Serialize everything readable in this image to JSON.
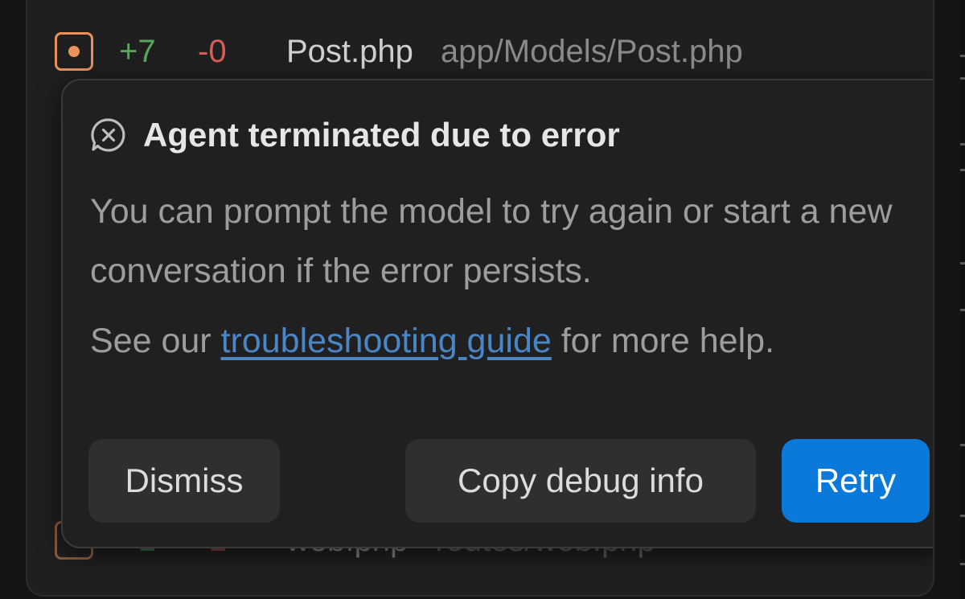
{
  "changed_files": [
    {
      "status_icon": "modified-file-icon",
      "additions": "+7",
      "deletions": "-0",
      "name": "Post.php",
      "path": "app/Models/Post.php"
    },
    {
      "status_icon": "modified-file-icon",
      "additions": "+1",
      "deletions": "-1",
      "name": "web.php",
      "path": "routes/web.php"
    }
  ],
  "error_card": {
    "icon": "error-chat-icon",
    "title": "Agent terminated due to error",
    "message": "You can prompt the model to try again or start a new conversation if the error persists.",
    "help_prefix": "See our ",
    "help_link": "troubleshooting guide",
    "help_suffix": " for more help.",
    "buttons": {
      "dismiss": "Dismiss",
      "copy_debug": "Copy debug info",
      "retry": "Retry"
    }
  },
  "colors": {
    "accent": "#0a79d9",
    "additions": "#58a55c",
    "deletions": "#d75b5b",
    "modified": "#e8915c",
    "link": "#4a86c5"
  }
}
